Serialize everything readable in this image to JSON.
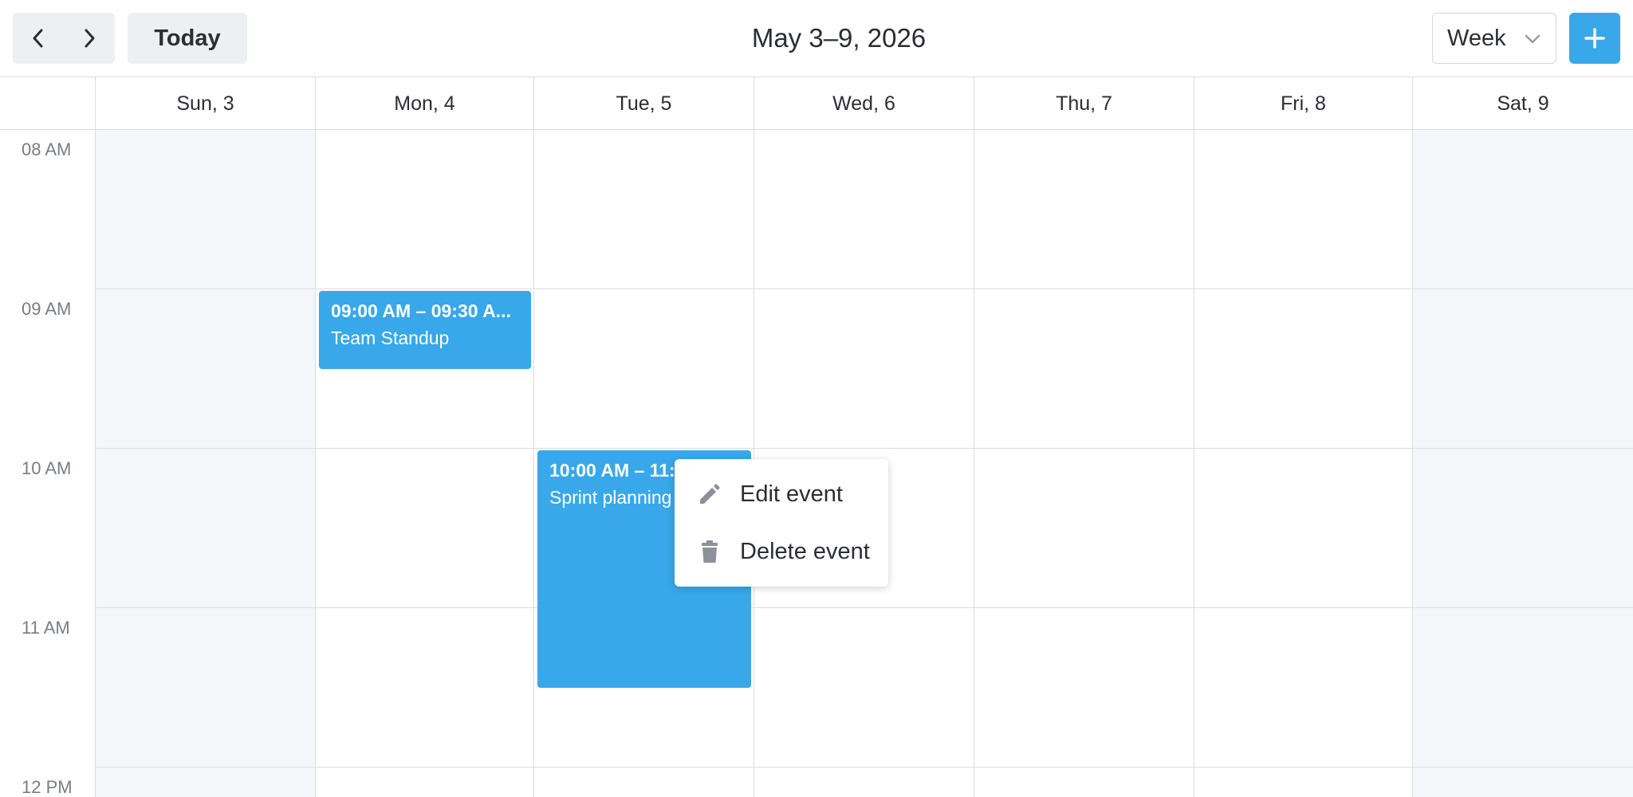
{
  "toolbar": {
    "today_label": "Today",
    "range_title": "May 3–9, 2026",
    "view_select": {
      "selected": "Week"
    },
    "add_label": "+"
  },
  "days": [
    {
      "label": "Sun, 3",
      "weekend": true
    },
    {
      "label": "Mon, 4",
      "weekend": false
    },
    {
      "label": "Tue, 5",
      "weekend": false
    },
    {
      "label": "Wed, 6",
      "weekend": false
    },
    {
      "label": "Thu, 7",
      "weekend": false
    },
    {
      "label": "Fri, 8",
      "weekend": false
    },
    {
      "label": "Sat, 9",
      "weekend": true
    }
  ],
  "time_labels": [
    "08 AM",
    "09 AM",
    "10 AM",
    "11 AM",
    "12 PM"
  ],
  "events": [
    {
      "time": "09:00 AM – 09:30 A...",
      "title": "Team Standup",
      "day": "Mon, 4"
    },
    {
      "time": "10:00 AM – 11:30 AM",
      "title": "Sprint planning",
      "day": "Tue, 5"
    }
  ],
  "context_menu": {
    "items": [
      {
        "label": "Edit event",
        "icon": "pencil-icon"
      },
      {
        "label": "Delete event",
        "icon": "trash-icon"
      }
    ]
  },
  "colors": {
    "accent": "#38a8ea",
    "weekend_bg": "#f5f6f9",
    "grid_line": "#dcdde2",
    "muted_text": "#7a7d87"
  }
}
